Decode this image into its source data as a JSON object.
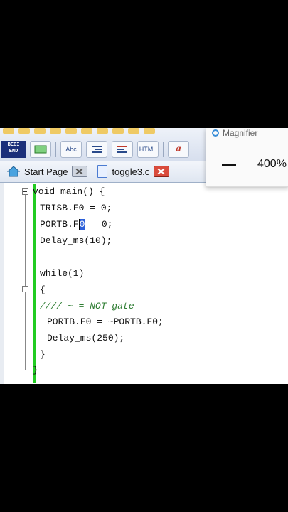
{
  "toolbar": {
    "begin_end_label": "BEGI\nEND",
    "abc_label": "Abc",
    "html_label": "HTML",
    "a_label": "a",
    "r_label": "R"
  },
  "tabs": [
    {
      "label": "Start Page",
      "icon": "home-icon"
    },
    {
      "label": "toggle3.c",
      "icon": "document-icon"
    }
  ],
  "magnifier": {
    "title": "Magnifier",
    "zoom": "400%"
  },
  "code_lines": [
    "void main() {",
    "TRISB.F0 = 0;",
    "Delay_ms(10);",
    "while(1)",
    "{",
    "//// ~ = NOT gate",
    "PORTB.F0 = ~PORTB.F0;",
    "Delay_ms(250);",
    "}",
    "}"
  ],
  "portb_line": {
    "before_sel": "PORTB.F",
    "selected": "0",
    "after": " = 0;"
  }
}
